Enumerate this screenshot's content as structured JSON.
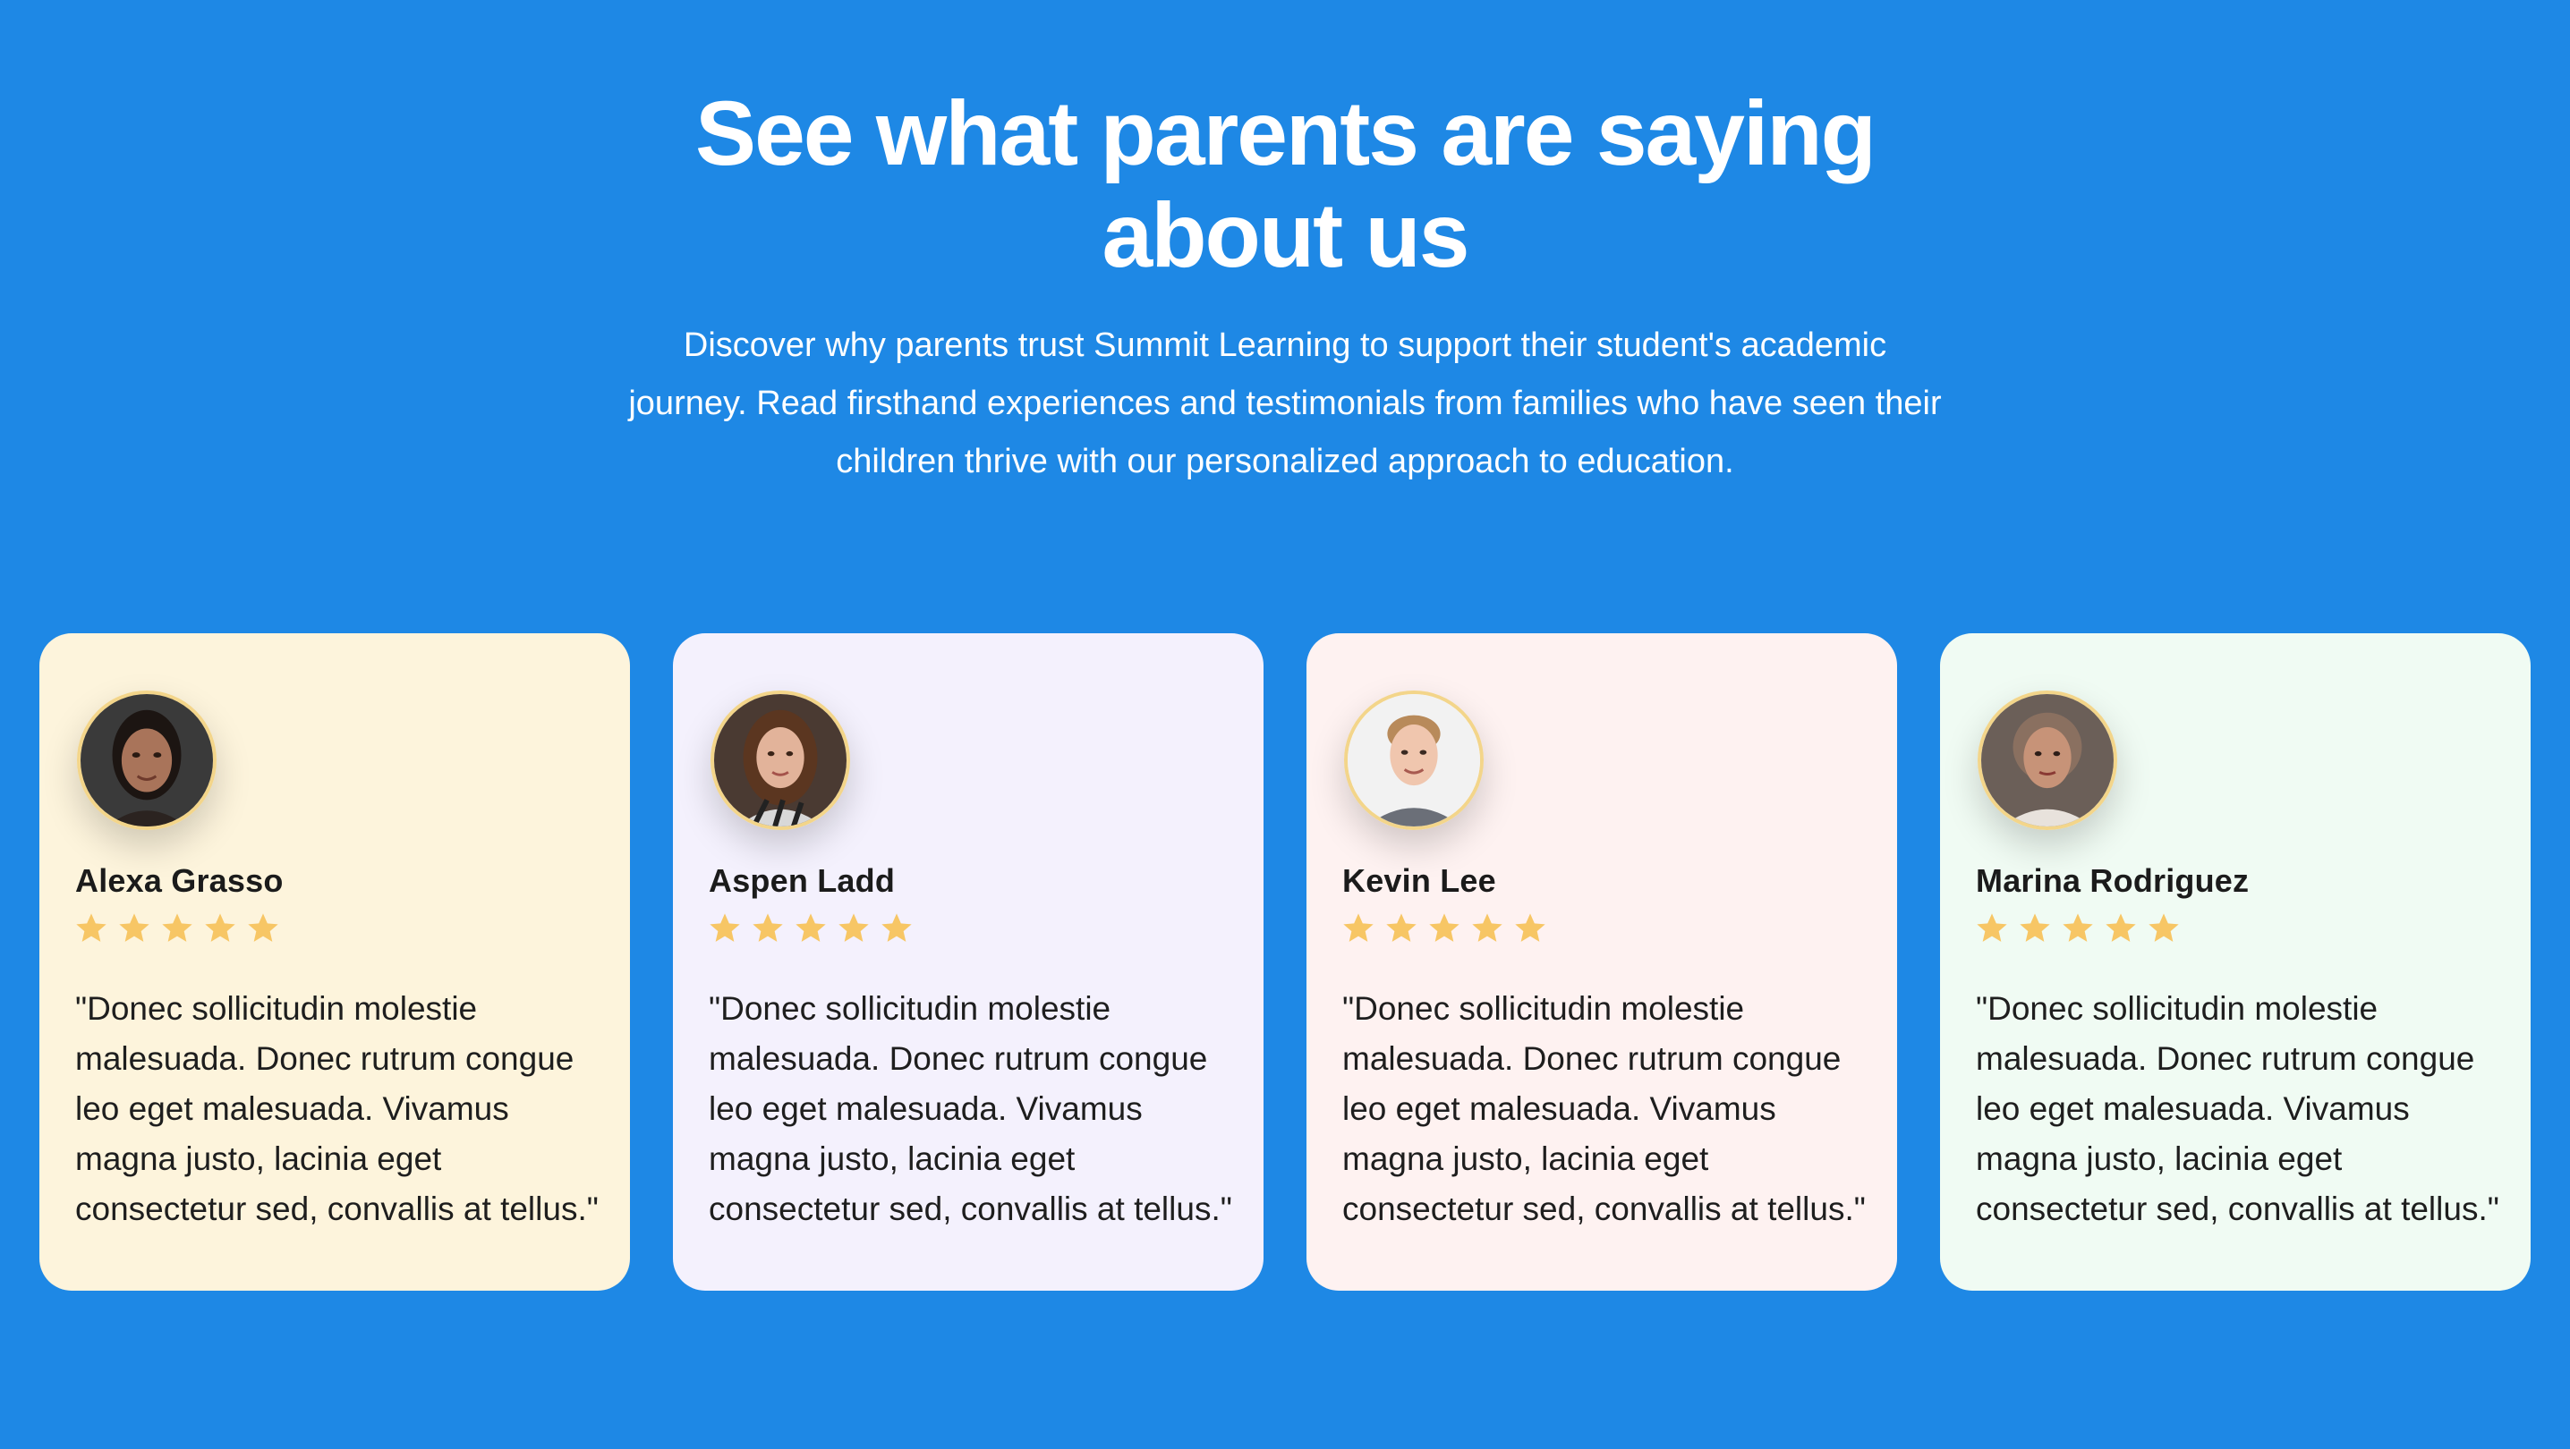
{
  "section": {
    "title_line1": "See what parents are saying",
    "title_line2": "about us",
    "subtitle_line1": "Discover why parents trust Summit Learning to support their student's academic",
    "subtitle_line2": "journey. Read firsthand experiences and testimonials from families who have seen their",
    "subtitle_line3": "children thrive with our personalized approach to education."
  },
  "colors": {
    "background": "#1e88e5",
    "star": "#f7c665"
  },
  "testimonials": [
    {
      "name": "Alexa Grasso",
      "rating": 5,
      "quote_lines": [
        "\"Donec sollicitudin molestie",
        "malesuada. Donec rutrum congue",
        "leo eget malesuada. Vivamus",
        "magna justo, lacinia eget",
        "consectetur sed, convallis at tellus.\""
      ],
      "card_color": "#fdf4dc"
    },
    {
      "name": "Aspen Ladd",
      "rating": 5,
      "quote_lines": [
        "\"Donec sollicitudin molestie",
        "malesuada. Donec rutrum congue",
        "leo eget malesuada. Vivamus",
        "magna justo, lacinia eget",
        "consectetur sed, convallis at tellus.\""
      ],
      "card_color": "#f4f1fd"
    },
    {
      "name": "Kevin Lee",
      "rating": 5,
      "quote_lines": [
        "\"Donec sollicitudin molestie",
        "malesuada. Donec rutrum congue",
        "leo eget malesuada. Vivamus",
        "magna justo, lacinia eget",
        "consectetur sed, convallis at tellus.\""
      ],
      "card_color": "#fef2f1"
    },
    {
      "name": "Marina Rodriguez",
      "rating": 5,
      "quote_lines": [
        "\"Donec sollicitudin molestie",
        "malesuada. Donec rutrum congue",
        "leo eget malesuada. Vivamus",
        "magna justo, lacinia eget",
        "consectetur sed, convallis at tellus.\""
      ],
      "card_color": "#f0fbf3"
    }
  ]
}
